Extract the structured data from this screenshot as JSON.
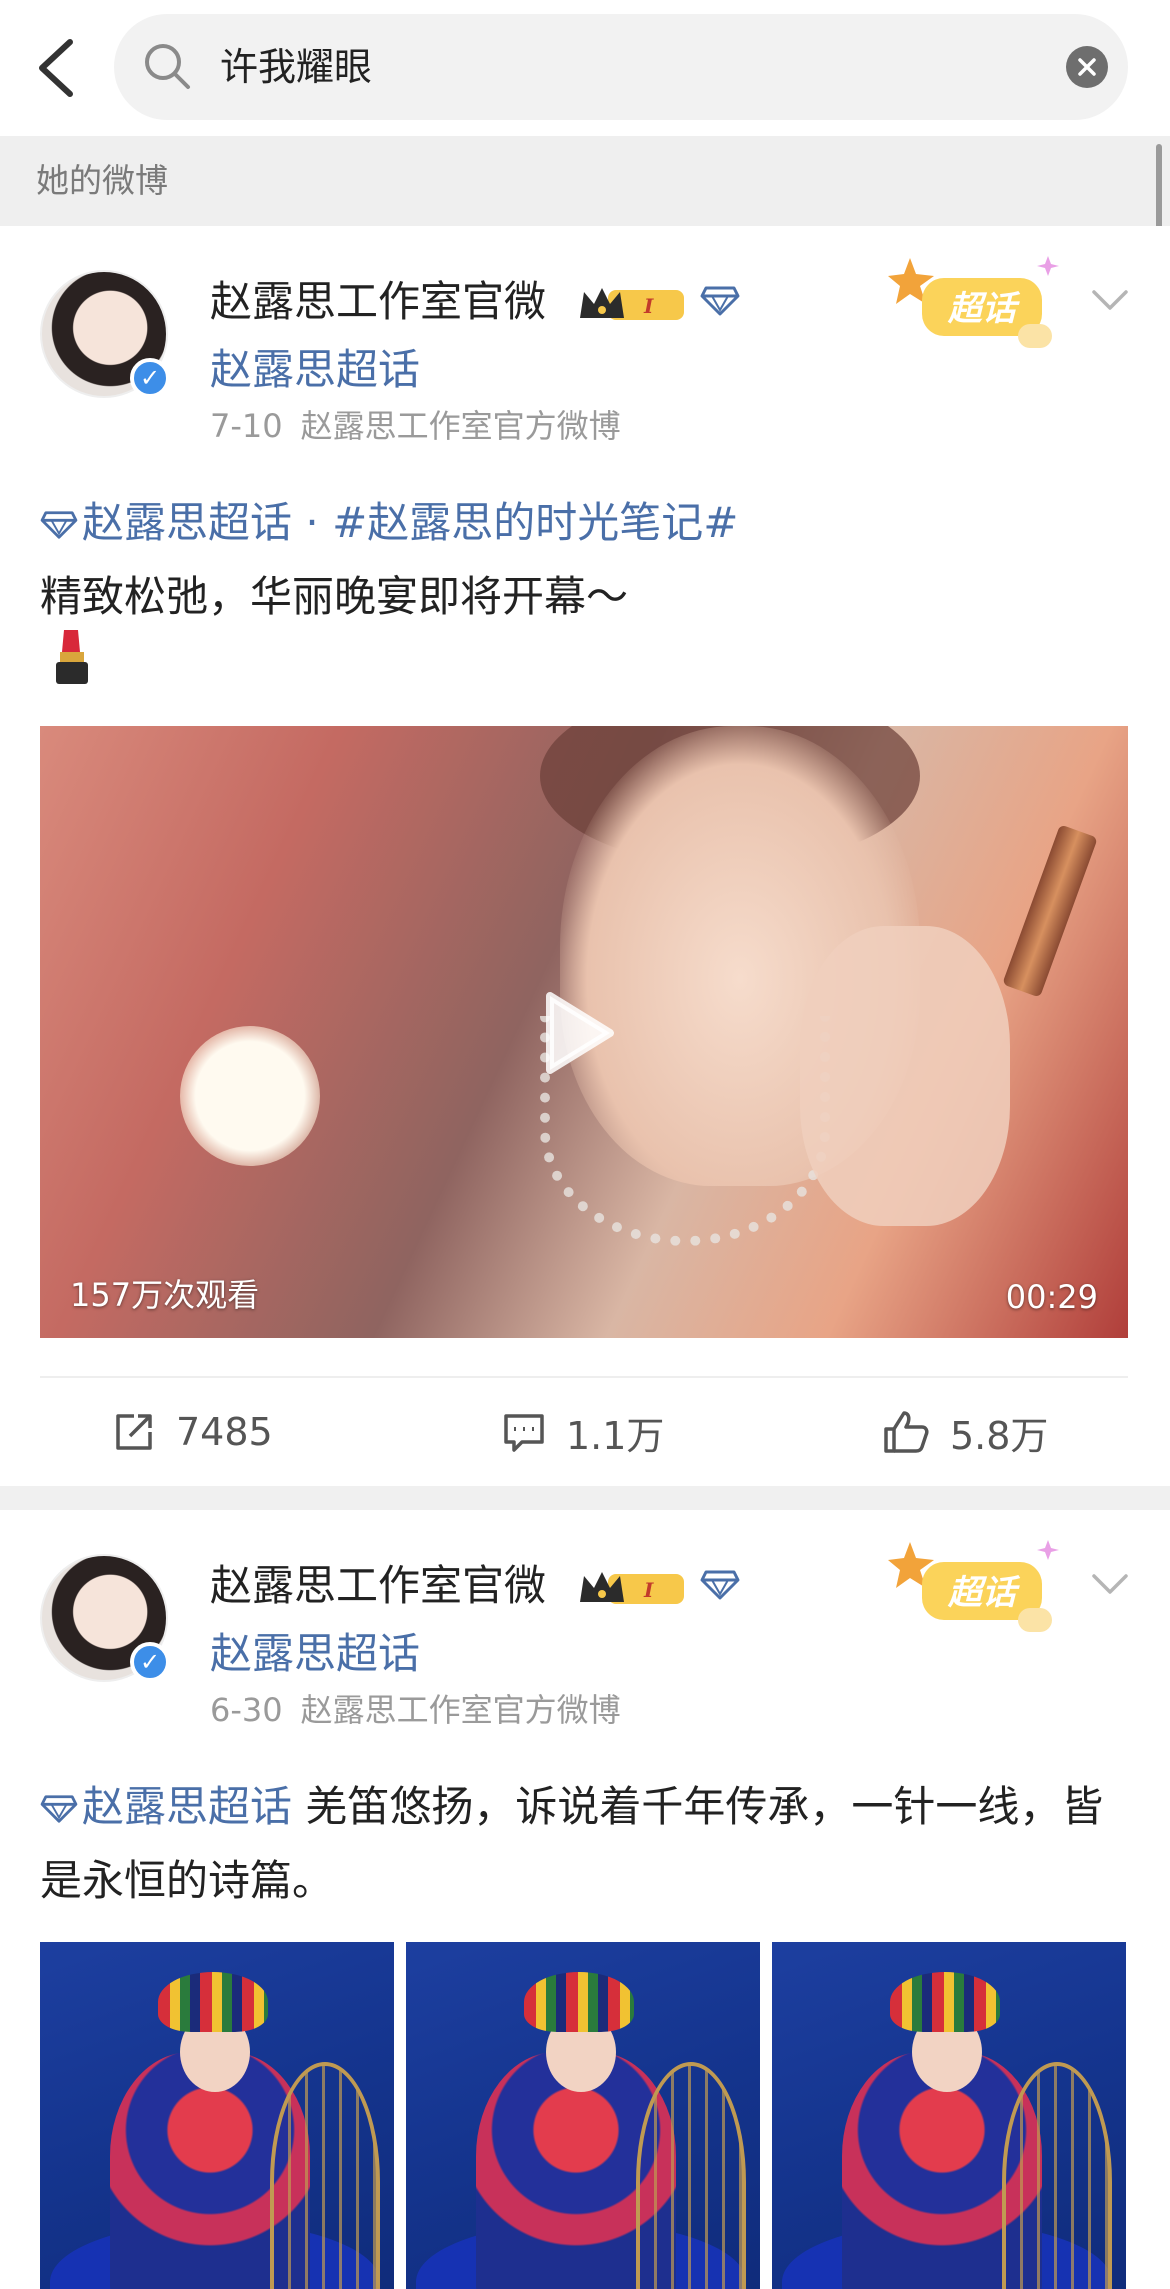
{
  "search": {
    "query": "许我耀眼"
  },
  "section": {
    "title": "她的微博"
  },
  "posts": [
    {
      "author": "赵露思工作室官微",
      "topic": "赵露思超话",
      "date": "7-10",
      "source": "赵露思工作室官方微博",
      "text": {
        "topic_link": "赵露思超话",
        "separator": " · ",
        "hashtag": "#赵露思的时光笔记#",
        "body": "精致松弛，华丽晚宴即将开幕～"
      },
      "video": {
        "views": "157万次观看",
        "duration": "00:29"
      },
      "stats": {
        "repost": "7485",
        "comment": "1.1万",
        "like": "5.8万"
      }
    },
    {
      "author": "赵露思工作室官微",
      "topic": "赵露思超话",
      "date": "6-30",
      "source": "赵露思工作室官方微博",
      "text": {
        "topic_link": "赵露思超话",
        "body": " 羌笛悠扬，诉说着千年传承，一针一线，皆是永恒的诗篇。"
      },
      "images": [
        "photo-1",
        "photo-2",
        "photo-3"
      ]
    }
  ],
  "badges": {
    "level": "I",
    "chaohua": "超话"
  },
  "icons": [
    "back-arrow-icon",
    "search-icon",
    "clear-icon",
    "crown-icon",
    "diamond-icon",
    "chevron-down-icon",
    "lipstick-emoji-icon",
    "play-icon",
    "repost-icon",
    "comment-icon",
    "like-icon"
  ],
  "colors": {
    "link": "#4a6fa8",
    "verified": "#3d8ee8",
    "badge_gold": "#f7c84a"
  }
}
